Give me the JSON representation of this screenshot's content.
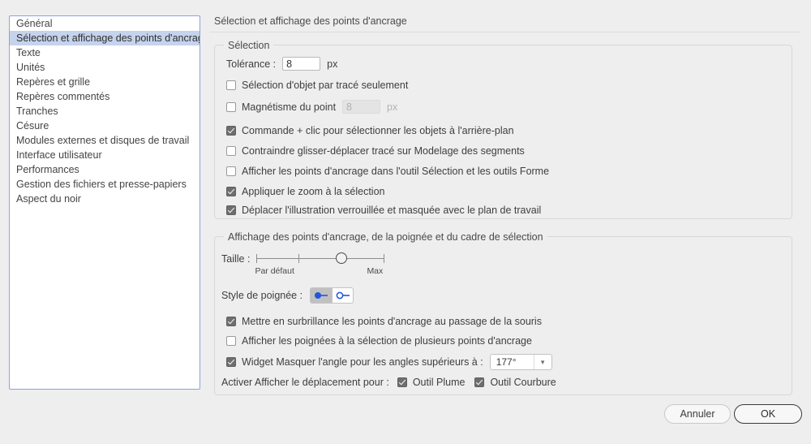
{
  "sidebar": {
    "items": [
      {
        "label": "Général",
        "selected": false
      },
      {
        "label": "Sélection et affichage des points d'ancrage",
        "selected": true
      },
      {
        "label": "Texte",
        "selected": false
      },
      {
        "label": "Unités",
        "selected": false
      },
      {
        "label": "Repères et grille",
        "selected": false
      },
      {
        "label": "Repères commentés",
        "selected": false
      },
      {
        "label": "Tranches",
        "selected": false
      },
      {
        "label": "Césure",
        "selected": false
      },
      {
        "label": "Modules externes et disques de travail",
        "selected": false
      },
      {
        "label": "Interface utilisateur",
        "selected": false
      },
      {
        "label": "Performances",
        "selected": false
      },
      {
        "label": "Gestion des fichiers et presse-papiers",
        "selected": false
      },
      {
        "label": "Aspect du noir",
        "selected": false
      }
    ]
  },
  "main": {
    "header_title": "Sélection et affichage des points d'ancrage",
    "selection_group": {
      "legend": "Sélection",
      "tolerance_label": "Tolérance :",
      "tolerance_value": "8",
      "tolerance_unit": "px",
      "checkbox_path_only": "Sélection d'objet par tracé seulement",
      "checkbox_snap": "Magnétisme du point",
      "snap_value": "8",
      "snap_unit": "px",
      "checkbox_command_click": "Commande + clic pour sélectionner les objets à l'arrière-plan",
      "checkbox_constrain": "Contraindre glisser-déplacer tracé sur Modelage des segments",
      "checkbox_show_anchors": "Afficher les points d'ancrage dans l'outil Sélection et les outils Forme",
      "checkbox_zoom_selection": "Appliquer le zoom à la sélection",
      "checkbox_move_locked": "Déplacer l'illustration verrouillée et masquée avec le plan de travail"
    },
    "display_group": {
      "legend": "Affichage des points d'ancrage, de la poignée et du cadre de sélection",
      "size_label": "Taille :",
      "size_min_caption": "Par défaut",
      "size_max_caption": "Max",
      "handle_style_label": "Style de poignée :",
      "handle_style_options": [
        "filled-handle-icon",
        "hollow-handle-icon"
      ],
      "checkbox_highlight": "Mettre en surbrillance les points d'ancrage au passage de la souris",
      "checkbox_show_handles": "Afficher les poignées à la sélection de plusieurs points d'ancrage",
      "checkbox_hide_corner": "Widget Masquer l'angle pour les angles supérieurs à :",
      "angle_value": "177°",
      "enable_show_label": "Activer Afficher le déplacement pour :",
      "checkbox_pen_tool": "Outil Plume",
      "checkbox_curvature_tool": "Outil Courbure"
    }
  },
  "footer": {
    "cancel_label": "Annuler",
    "ok_label": "OK"
  }
}
